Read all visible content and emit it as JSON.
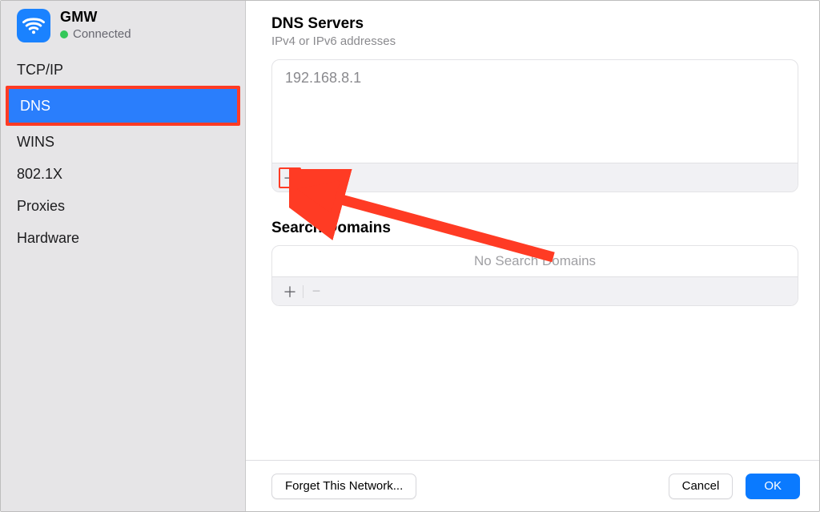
{
  "sidebar": {
    "network_name": "GMW",
    "status_label": "Connected",
    "items": [
      {
        "label": "TCP/IP"
      },
      {
        "label": "DNS"
      },
      {
        "label": "WINS"
      },
      {
        "label": "802.1X"
      },
      {
        "label": "Proxies"
      },
      {
        "label": "Hardware"
      }
    ],
    "selected_index": 1
  },
  "dns": {
    "title": "DNS Servers",
    "subtitle": "IPv4 or IPv6 addresses",
    "servers": [
      "192.168.8.1"
    ]
  },
  "search_domains": {
    "title": "Search Domains",
    "empty_label": "No Search Domains"
  },
  "footer": {
    "forget_label": "Forget This Network...",
    "cancel_label": "Cancel",
    "ok_label": "OK"
  },
  "colors": {
    "accent": "#0a7aff",
    "selection": "#2a7efc",
    "annotation": "#ff3b24"
  }
}
